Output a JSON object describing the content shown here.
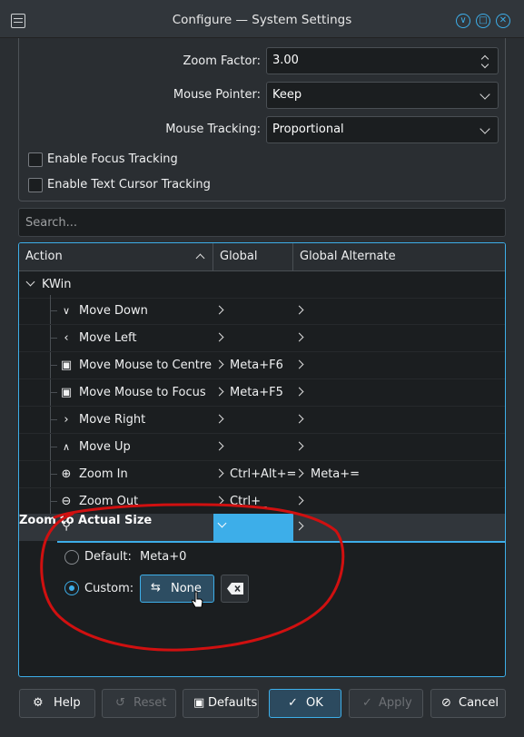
{
  "window": {
    "title": "Configure — System Settings",
    "accent_color": "#3daee9",
    "buttons": [
      "minimize",
      "maximize",
      "close"
    ]
  },
  "settings": {
    "zoom_factor_label": "Zoom Factor:",
    "zoom_factor_value": "3.00",
    "mouse_pointer_label": "Mouse Pointer:",
    "mouse_pointer_value": "Keep",
    "mouse_tracking_label": "Mouse Tracking:",
    "mouse_tracking_value": "Proportional",
    "focus_tracking_label": "Enable Focus Tracking",
    "focus_tracking_checked": false,
    "text_cursor_label": "Enable Text Cursor Tracking",
    "text_cursor_checked": false
  },
  "search": {
    "placeholder": "Search..."
  },
  "tree": {
    "columns": [
      "Action",
      "Global",
      "Global Alternate"
    ],
    "group": "KWin",
    "rows": [
      {
        "icon": "chevron-down-icon",
        "action": "Move Down",
        "global": "",
        "alternate": ""
      },
      {
        "icon": "chevron-left-icon",
        "action": "Move Left",
        "global": "",
        "alternate": ""
      },
      {
        "icon": "mouse-move-icon",
        "action": "Move Mouse to Centre",
        "global": "Meta+F6",
        "alternate": ""
      },
      {
        "icon": "mouse-move-icon",
        "action": "Move Mouse to Focus",
        "global": "Meta+F5",
        "alternate": ""
      },
      {
        "icon": "chevron-right-icon",
        "action": "Move Right",
        "global": "",
        "alternate": ""
      },
      {
        "icon": "chevron-up-icon",
        "action": "Move Up",
        "global": "",
        "alternate": ""
      },
      {
        "icon": "zoom-in-icon",
        "action": "Zoom In",
        "global": "Ctrl+Alt+=",
        "alternate": "Meta+="
      },
      {
        "icon": "zoom-out-icon",
        "action": "Zoom Out",
        "global": "Ctrl+_",
        "alternate": ""
      }
    ],
    "selected": {
      "icon": "zoom-original-icon",
      "action": "Zoom to Actual Size",
      "default_label": "Default:",
      "default_value": "Meta+0",
      "custom_label": "Custom:",
      "custom_button": "None",
      "custom_selected": true
    }
  },
  "buttons": {
    "help": "Help",
    "reset": "Reset",
    "defaults": "Defaults",
    "ok": "OK",
    "apply": "Apply",
    "cancel": "Cancel"
  },
  "annotation_color": "#d01010"
}
